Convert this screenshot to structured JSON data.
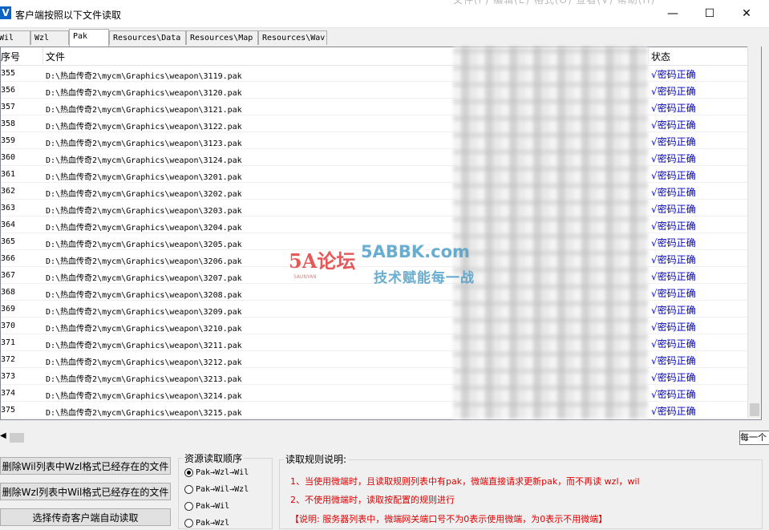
{
  "window": {
    "title": "客户端按照以下文件读取",
    "app_icon": "V",
    "background_menu": "文件(F)   编辑(E)   格式(O)   查看(V)   帮助(H)"
  },
  "controls": {
    "minimize": "—",
    "maximize": "☐",
    "close": "✕"
  },
  "tabs": [
    {
      "label": "Wil"
    },
    {
      "label": "Wzl"
    },
    {
      "label": "Pak",
      "active": true
    },
    {
      "label": "Resources\\Data"
    },
    {
      "label": "Resources\\Map"
    },
    {
      "label": "Resources\\Wav"
    }
  ],
  "table": {
    "columns": {
      "no": "序号",
      "file": "文件",
      "status": "状态"
    },
    "rows": [
      {
        "no": "355",
        "file": "D:\\热血传奇2\\mycm\\Graphics\\weapon\\3119.pak",
        "status": "√密码正确"
      },
      {
        "no": "356",
        "file": "D:\\热血传奇2\\mycm\\Graphics\\weapon\\3120.pak",
        "status": "√密码正确"
      },
      {
        "no": "357",
        "file": "D:\\热血传奇2\\mycm\\Graphics\\weapon\\3121.pak",
        "status": "√密码正确"
      },
      {
        "no": "358",
        "file": "D:\\热血传奇2\\mycm\\Graphics\\weapon\\3122.pak",
        "status": "√密码正确"
      },
      {
        "no": "359",
        "file": "D:\\热血传奇2\\mycm\\Graphics\\weapon\\3123.pak",
        "status": "√密码正确"
      },
      {
        "no": "360",
        "file": "D:\\热血传奇2\\mycm\\Graphics\\weapon\\3124.pak",
        "status": "√密码正确"
      },
      {
        "no": "361",
        "file": "D:\\热血传奇2\\mycm\\Graphics\\weapon\\3201.pak",
        "status": "√密码正确"
      },
      {
        "no": "362",
        "file": "D:\\热血传奇2\\mycm\\Graphics\\weapon\\3202.pak",
        "status": "√密码正确"
      },
      {
        "no": "363",
        "file": "D:\\热血传奇2\\mycm\\Graphics\\weapon\\3203.pak",
        "status": "√密码正确"
      },
      {
        "no": "364",
        "file": "D:\\热血传奇2\\mycm\\Graphics\\weapon\\3204.pak",
        "status": "√密码正确"
      },
      {
        "no": "365",
        "file": "D:\\热血传奇2\\mycm\\Graphics\\weapon\\3205.pak",
        "status": "√密码正确"
      },
      {
        "no": "366",
        "file": "D:\\热血传奇2\\mycm\\Graphics\\weapon\\3206.pak",
        "status": "√密码正确"
      },
      {
        "no": "367",
        "file": "D:\\热血传奇2\\mycm\\Graphics\\weapon\\3207.pak",
        "status": "√密码正确"
      },
      {
        "no": "368",
        "file": "D:\\热血传奇2\\mycm\\Graphics\\weapon\\3208.pak",
        "status": "√密码正确"
      },
      {
        "no": "369",
        "file": "D:\\热血传奇2\\mycm\\Graphics\\weapon\\3209.pak",
        "status": "√密码正确"
      },
      {
        "no": "370",
        "file": "D:\\热血传奇2\\mycm\\Graphics\\weapon\\3210.pak",
        "status": "√密码正确"
      },
      {
        "no": "371",
        "file": "D:\\热血传奇2\\mycm\\Graphics\\weapon\\3211.pak",
        "status": "√密码正确"
      },
      {
        "no": "372",
        "file": "D:\\热血传奇2\\mycm\\Graphics\\weapon\\3212.pak",
        "status": "√密码正确"
      },
      {
        "no": "373",
        "file": "D:\\热血传奇2\\mycm\\Graphics\\weapon\\3213.pak",
        "status": "√密码正确"
      },
      {
        "no": "374",
        "file": "D:\\热血传奇2\\mycm\\Graphics\\weapon\\3214.pak",
        "status": "√密码正确"
      },
      {
        "no": "375",
        "file": "D:\\热血传奇2\\mycm\\Graphics\\weapon\\3215.pak",
        "status": "√密码正确"
      }
    ]
  },
  "watermark": {
    "logo": "5A论坛",
    "logo_sub": "5AUNYAN",
    "url": "5ABBK.com",
    "slogan": "技术赋能每一战"
  },
  "tooltip": "每一个",
  "buttons": {
    "delete_wil": "删除Wil列表中Wzl格式已经存在的文件",
    "delete_wzl": "删除Wzl列表中Wil格式已经存在的文件",
    "auto_read": "选择传奇客户端自动读取"
  },
  "order_group": {
    "title": "资源读取顺序",
    "options": [
      {
        "label": "Pak→Wzl→Wil",
        "checked": true
      },
      {
        "label": "Pak→Wil→Wzl",
        "checked": false
      },
      {
        "label": "Pak→Wil",
        "checked": false
      },
      {
        "label": "Pak→Wzl",
        "checked": false
      }
    ]
  },
  "rules_group": {
    "title": "读取规则说明:",
    "rule1": "1、当使用微端时，且读取规则列表中有pak，微端直接请求更新pak，而不再读 wzl，wil",
    "rule2": "2、不使用微端时，读取按配置的规则进行",
    "note": "【说明: 服务器列表中，微端网关端口号不为0表示使用微端，为0表示不用微端】"
  },
  "colors": {
    "status": "#0000c0",
    "rule_text": "#e00000",
    "accent": "#0b63c4"
  }
}
